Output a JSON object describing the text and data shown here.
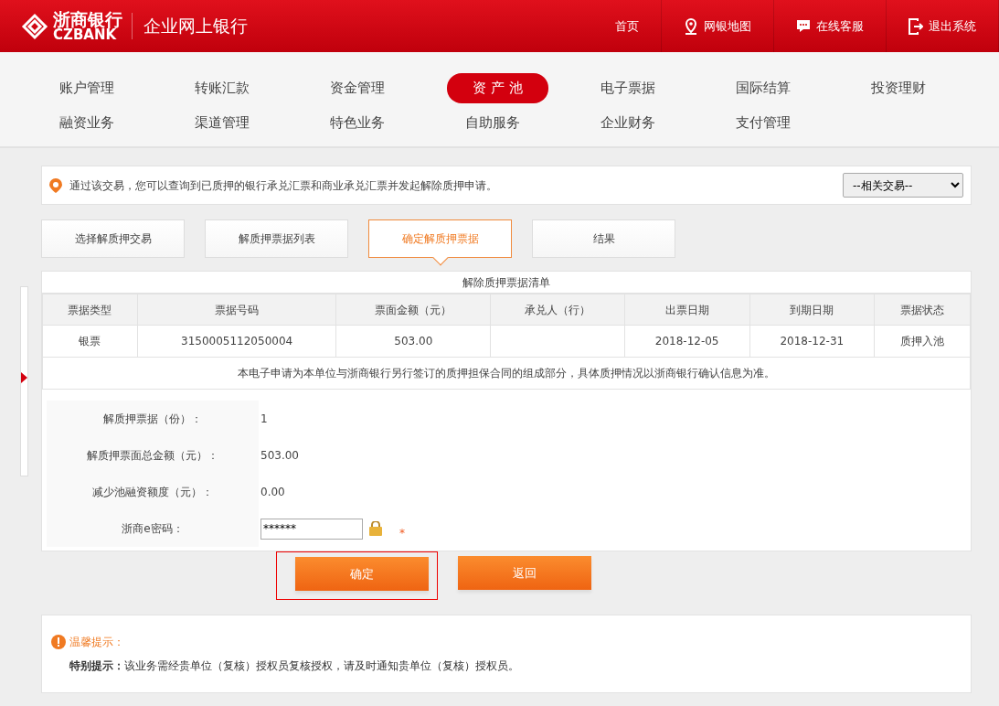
{
  "header": {
    "logo_cn": "浙商银行",
    "logo_en": "CZBANK",
    "title": "企业网上银行",
    "links": [
      {
        "label": "首页",
        "kind": "plain"
      },
      {
        "label": "网银地图",
        "kind": "map"
      },
      {
        "label": "在线客服",
        "kind": "service"
      },
      {
        "label": "退出系统",
        "kind": "logout"
      }
    ]
  },
  "nav": [
    [
      {
        "label": "账户管理",
        "selected": false
      },
      {
        "label": "转账汇款",
        "selected": false
      },
      {
        "label": "资金管理",
        "selected": false
      },
      {
        "label": "资 产 池",
        "selected": true
      },
      {
        "label": "电子票据",
        "selected": false
      },
      {
        "label": "国际结算",
        "selected": false
      },
      {
        "label": "投资理财",
        "selected": false
      }
    ],
    [
      {
        "label": "融资业务",
        "selected": false
      },
      {
        "label": "渠道管理",
        "selected": false
      },
      {
        "label": "特色业务",
        "selected": false
      },
      {
        "label": "自助服务",
        "selected": false
      },
      {
        "label": "企业财务",
        "selected": false
      },
      {
        "label": "支付管理",
        "selected": false
      }
    ]
  ],
  "notice": {
    "text": "通过该交易，您可以查询到已质押的银行承兑汇票和商业承兑汇票并发起解除质押申请。",
    "related_select": "--相关交易--"
  },
  "steps": [
    {
      "label": "选择解质押交易",
      "selected": false
    },
    {
      "label": "解质押票据列表",
      "selected": false
    },
    {
      "label": "确定解质押票据",
      "selected": true
    },
    {
      "label": "结果",
      "selected": false
    }
  ],
  "table": {
    "title": "解除质押票据清单",
    "columns": [
      "票据类型",
      "票据号码",
      "票面金额（元）",
      "承兑人（行）",
      "出票日期",
      "到期日期",
      "票据状态"
    ],
    "rows": [
      [
        "银票",
        "3150005112050004",
        "503.00",
        "",
        "2018-12-05",
        "2018-12-31",
        "质押入池"
      ]
    ],
    "note": "本电子申请为本单位与浙商银行另行签订的质押担保合同的组成部分，具体质押情况以浙商银行确认信息为准。"
  },
  "form": [
    {
      "kind": "text",
      "label": "解质押票据（份）：",
      "value": "1"
    },
    {
      "kind": "text",
      "label": "解质押票面总金额（元）：",
      "value": "503.00"
    },
    {
      "kind": "text",
      "label": "减少池融资额度（元）：",
      "value": "0.00"
    },
    {
      "kind": "password",
      "label": "浙商e密码：",
      "value": "******",
      "required": "*"
    }
  ],
  "buttons": [
    {
      "label": "确定",
      "highlighted": true
    },
    {
      "label": "返回",
      "highlighted": false
    }
  ],
  "tip": {
    "title": "温馨提示：",
    "text": "**特别提示：**该业务需经贵单位（复核）授权员复核授权，请及时通知贵单位（复核）授权员。"
  }
}
